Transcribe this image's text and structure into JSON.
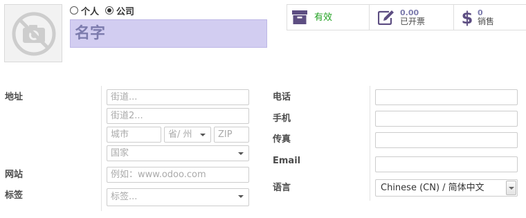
{
  "partner_type": {
    "options": [
      {
        "label": "个人",
        "selected": false
      },
      {
        "label": "公司",
        "selected": true
      }
    ]
  },
  "name": {
    "placeholder": "名字",
    "value": ""
  },
  "avatar": {
    "icon": "camera-off-icon"
  },
  "stats": [
    {
      "icon": "archive-icon",
      "label": "有效",
      "value": "",
      "color": "#21a121"
    },
    {
      "icon": "edit-icon",
      "label": "已开票",
      "value": "0.00"
    },
    {
      "icon": "dollar-icon",
      "label": "销售",
      "value": "0"
    }
  ],
  "address": {
    "label": "地址",
    "street": {
      "placeholder": "街道..."
    },
    "street2": {
      "placeholder": "街道2..."
    },
    "city": {
      "placeholder": "城市"
    },
    "state": {
      "placeholder": "省/ 州"
    },
    "zip": {
      "placeholder": "ZIP"
    },
    "country": {
      "placeholder": "国家"
    }
  },
  "website": {
    "label": "网站",
    "placeholder": "例如：www.odoo.com"
  },
  "tags": {
    "label": "标签",
    "placeholder": "标签..."
  },
  "phone": {
    "label": "电话",
    "value": ""
  },
  "mobile": {
    "label": "手机",
    "value": ""
  },
  "fax": {
    "label": "传真",
    "value": ""
  },
  "email": {
    "label": "Email",
    "value": ""
  },
  "language": {
    "label": "语言",
    "value": "Chinese (CN) / 简体中文"
  }
}
